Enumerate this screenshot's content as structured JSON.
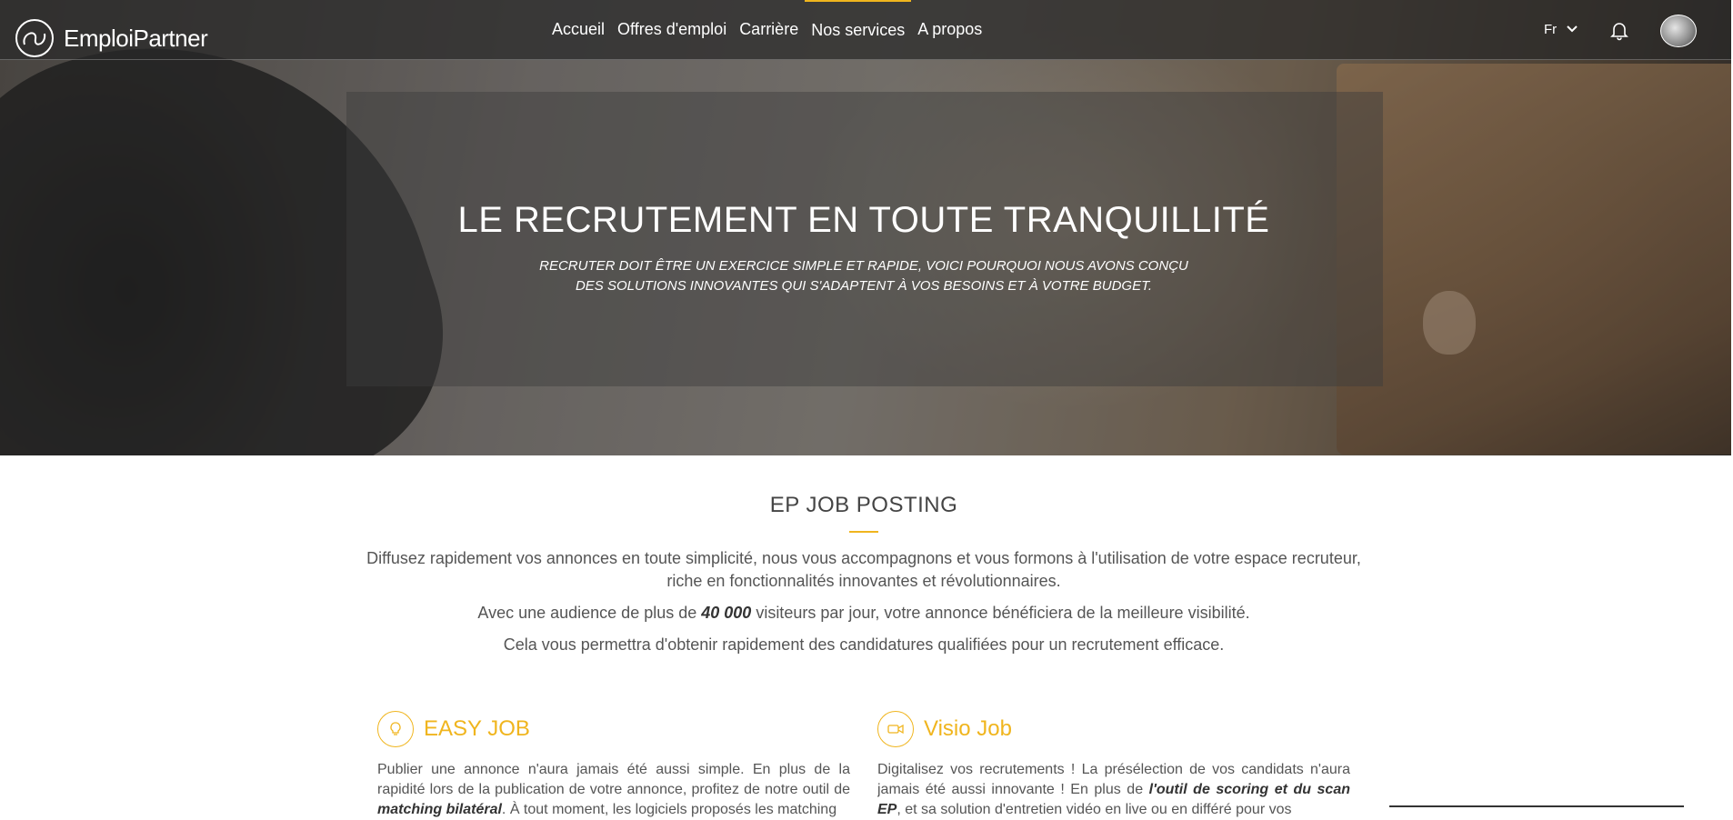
{
  "brand": {
    "name": "EmploiPartner"
  },
  "nav": {
    "items": [
      {
        "label": "Accueil"
      },
      {
        "label": "Offres d'emploi"
      },
      {
        "label": "Carrière"
      },
      {
        "label": "Nos services"
      },
      {
        "label": "A propos"
      }
    ],
    "active": "Nos services"
  },
  "header_right": {
    "language": "Fr"
  },
  "hero": {
    "title": "LE RECRUTEMENT EN TOUTE TRANQUILLITÉ",
    "subtitle_line1": "RECRUTER DOIT ÊTRE UN EXERCICE SIMPLE ET RAPIDE, VOICI POURQUOI NOUS AVONS CONÇU",
    "subtitle_line2": "DES SOLUTIONS INNOVANTES QUI S'ADAPTENT À VOS BESOINS ET À VOTRE BUDGET."
  },
  "section": {
    "title": "EP JOB POSTING",
    "p1_line1": "Diffusez rapidement vos annonces en toute simplicité, nous vous accompagnons et vous formons à l'utilisation de votre espace recruteur,",
    "p1_line2": "riche en fonctionnalités innovantes et révolutionnaires.",
    "p2_before": "Avec une audience de plus de ",
    "p2_bold": "40 000",
    "p2_after": " visiteurs par jour, votre annonce bénéficiera de la meilleure visibilité.",
    "p3": "Cela vous permettra d'obtenir rapidement des candidatures qualifiées pour un recrutement efficace."
  },
  "features": [
    {
      "icon": "lightbulb-icon",
      "title": "EASY JOB",
      "text_before": "Publier une annonce n'aura jamais été aussi simple. En plus de la rapidité lors de la publication de votre annonce, profitez de notre outil de ",
      "text_bold": "matching bilatéral",
      "text_after": ". À tout moment, les logiciels proposés les matching"
    },
    {
      "icon": "video-camera-icon",
      "title": "Visio Job",
      "text_before": "Digitalisez vos recrutements ! La présélection de vos candidats n'aura jamais été aussi innovante ! En plus de ",
      "text_bold": "l'outil de scoring et du scan EP",
      "text_after": ", et sa solution d'entretien vidéo en live ou en différé pour vos"
    }
  ],
  "colors": {
    "accent": "#f0b51e",
    "nav_bg": "#2b2b2b",
    "text": "#555555"
  }
}
